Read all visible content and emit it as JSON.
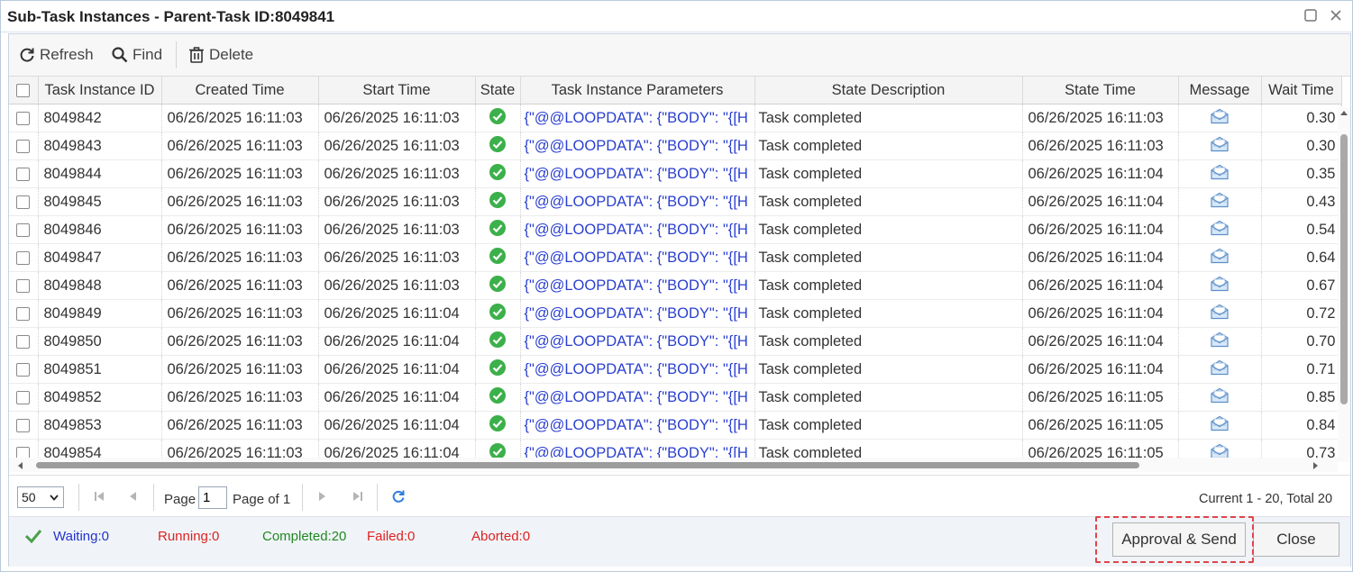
{
  "window": {
    "title": "Sub-Task Instances - Parent-Task ID:8049841"
  },
  "toolbar": {
    "refresh": "Refresh",
    "find": "Find",
    "delete": "Delete"
  },
  "columns": [
    "Task Instance ID",
    "Created Time",
    "Start Time",
    "State",
    "Task Instance Parameters",
    "State Description",
    "State Time",
    "Message",
    "Wait Time"
  ],
  "rows": [
    {
      "id": "8049842",
      "created": "06/26/2025 16:11:03",
      "start": "06/26/2025 16:11:03",
      "params": "{\"@@LOOPDATA\": {\"BODY\": \"{[H",
      "desc": "Task completed",
      "state_time": "06/26/2025 16:11:03",
      "wait": "0.30"
    },
    {
      "id": "8049843",
      "created": "06/26/2025 16:11:03",
      "start": "06/26/2025 16:11:03",
      "params": "{\"@@LOOPDATA\": {\"BODY\": \"{[H",
      "desc": "Task completed",
      "state_time": "06/26/2025 16:11:03",
      "wait": "0.30"
    },
    {
      "id": "8049844",
      "created": "06/26/2025 16:11:03",
      "start": "06/26/2025 16:11:03",
      "params": "{\"@@LOOPDATA\": {\"BODY\": \"{[H",
      "desc": "Task completed",
      "state_time": "06/26/2025 16:11:04",
      "wait": "0.35"
    },
    {
      "id": "8049845",
      "created": "06/26/2025 16:11:03",
      "start": "06/26/2025 16:11:03",
      "params": "{\"@@LOOPDATA\": {\"BODY\": \"{[H",
      "desc": "Task completed",
      "state_time": "06/26/2025 16:11:04",
      "wait": "0.43"
    },
    {
      "id": "8049846",
      "created": "06/26/2025 16:11:03",
      "start": "06/26/2025 16:11:03",
      "params": "{\"@@LOOPDATA\": {\"BODY\": \"{[H",
      "desc": "Task completed",
      "state_time": "06/26/2025 16:11:04",
      "wait": "0.54"
    },
    {
      "id": "8049847",
      "created": "06/26/2025 16:11:03",
      "start": "06/26/2025 16:11:03",
      "params": "{\"@@LOOPDATA\": {\"BODY\": \"{[H",
      "desc": "Task completed",
      "state_time": "06/26/2025 16:11:04",
      "wait": "0.64"
    },
    {
      "id": "8049848",
      "created": "06/26/2025 16:11:03",
      "start": "06/26/2025 16:11:03",
      "params": "{\"@@LOOPDATA\": {\"BODY\": \"{[H",
      "desc": "Task completed",
      "state_time": "06/26/2025 16:11:04",
      "wait": "0.67"
    },
    {
      "id": "8049849",
      "created": "06/26/2025 16:11:03",
      "start": "06/26/2025 16:11:04",
      "params": "{\"@@LOOPDATA\": {\"BODY\": \"{[H",
      "desc": "Task completed",
      "state_time": "06/26/2025 16:11:04",
      "wait": "0.72"
    },
    {
      "id": "8049850",
      "created": "06/26/2025 16:11:03",
      "start": "06/26/2025 16:11:04",
      "params": "{\"@@LOOPDATA\": {\"BODY\": \"{[H",
      "desc": "Task completed",
      "state_time": "06/26/2025 16:11:04",
      "wait": "0.70"
    },
    {
      "id": "8049851",
      "created": "06/26/2025 16:11:03",
      "start": "06/26/2025 16:11:04",
      "params": "{\"@@LOOPDATA\": {\"BODY\": \"{[H",
      "desc": "Task completed",
      "state_time": "06/26/2025 16:11:04",
      "wait": "0.71"
    },
    {
      "id": "8049852",
      "created": "06/26/2025 16:11:03",
      "start": "06/26/2025 16:11:04",
      "params": "{\"@@LOOPDATA\": {\"BODY\": \"{[H",
      "desc": "Task completed",
      "state_time": "06/26/2025 16:11:05",
      "wait": "0.85"
    },
    {
      "id": "8049853",
      "created": "06/26/2025 16:11:03",
      "start": "06/26/2025 16:11:04",
      "params": "{\"@@LOOPDATA\": {\"BODY\": \"{[H",
      "desc": "Task completed",
      "state_time": "06/26/2025 16:11:05",
      "wait": "0.84"
    },
    {
      "id": "8049854",
      "created": "06/26/2025 16:11:03",
      "start": "06/26/2025 16:11:04",
      "params": "{\"@@LOOPDATA\": {\"BODY\": \"{[H",
      "desc": "Task completed",
      "state_time": "06/26/2025 16:11:05",
      "wait": "0.73"
    }
  ],
  "row_state_icon": "check-circle-icon",
  "row_message_icon": "envelope-icon",
  "pager": {
    "page_size": "50",
    "page_label": "Page",
    "page_value": "1",
    "page_of": "Page of 1",
    "summary": "Current 1 - 20, Total 20"
  },
  "status": {
    "waiting": "Waiting:0",
    "running": "Running:0",
    "completed": "Completed:20",
    "failed": "Failed:0",
    "aborted": "Aborted:0"
  },
  "buttons": {
    "approval_send": "Approval & Send",
    "close": "Close"
  },
  "colors": {
    "waiting": "#2233cc",
    "running": "#dd2222",
    "completed": "#228822",
    "failed": "#dd2222",
    "aborted": "#dd2222",
    "param_text": "#2a3fd0",
    "state_ok": "#3cb04a",
    "highlight": "#e0444a"
  }
}
